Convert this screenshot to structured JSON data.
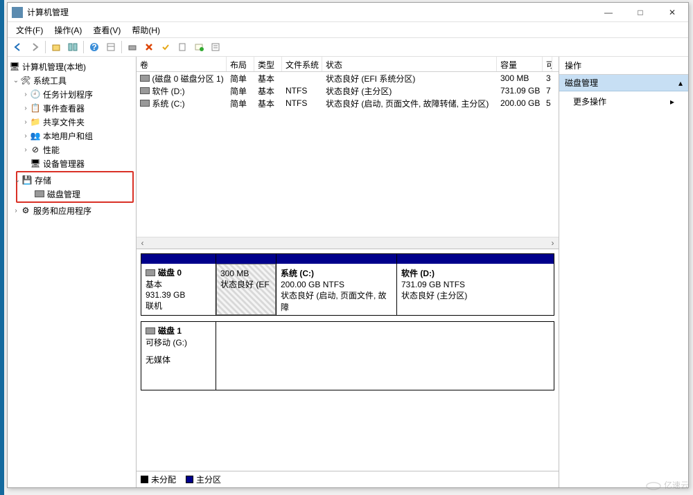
{
  "window": {
    "title": "计算机管理",
    "min": "—",
    "max": "□",
    "close": "✕"
  },
  "menu": {
    "file": "文件(F)",
    "action": "操作(A)",
    "view": "查看(V)",
    "help": "帮助(H)"
  },
  "tree": {
    "root": "计算机管理(本地)",
    "systools": "系统工具",
    "task": "任务计划程序",
    "event": "事件查看器",
    "share": "共享文件夹",
    "users": "本地用户和组",
    "perf": "性能",
    "devmgr": "设备管理器",
    "storage": "存储",
    "diskmgmt": "磁盘管理",
    "services": "服务和应用程序"
  },
  "columns": {
    "volume": "卷",
    "layout": "布局",
    "type": "类型",
    "fs": "文件系统",
    "status": "状态",
    "capacity": "容量",
    "free": "可"
  },
  "rows": [
    {
      "vol": "(磁盘 0 磁盘分区 1)",
      "layout": "简单",
      "type": "基本",
      "fs": "",
      "status": "状态良好 (EFI 系统分区)",
      "cap": "300 MB",
      "free": "3"
    },
    {
      "vol": "软件 (D:)",
      "layout": "简单",
      "type": "基本",
      "fs": "NTFS",
      "status": "状态良好 (主分区)",
      "cap": "731.09 GB",
      "free": "7"
    },
    {
      "vol": "系统 (C:)",
      "layout": "简单",
      "type": "基本",
      "fs": "NTFS",
      "status": "状态良好 (启动, 页面文件, 故障转储, 主分区)",
      "cap": "200.00 GB",
      "free": "5"
    }
  ],
  "disk0": {
    "name": "磁盘 0",
    "type": "基本",
    "size": "931.39 GB",
    "state": "联机",
    "p1size": "300 MB",
    "p1status": "状态良好 (EF",
    "p2name": "系统 (C:)",
    "p2size": "200.00 GB NTFS",
    "p2status": "状态良好 (启动, 页面文件, 故障",
    "p3name": "软件 (D:)",
    "p3size": "731.09 GB NTFS",
    "p3status": "状态良好 (主分区)"
  },
  "disk1": {
    "name": "磁盘 1",
    "type": "可移动 (G:)",
    "state": "无媒体"
  },
  "legend": {
    "unalloc": "未分配",
    "primary": "主分区"
  },
  "actions": {
    "title": "操作",
    "band": "磁盘管理",
    "more": "更多操作"
  },
  "watermark": "亿速云"
}
